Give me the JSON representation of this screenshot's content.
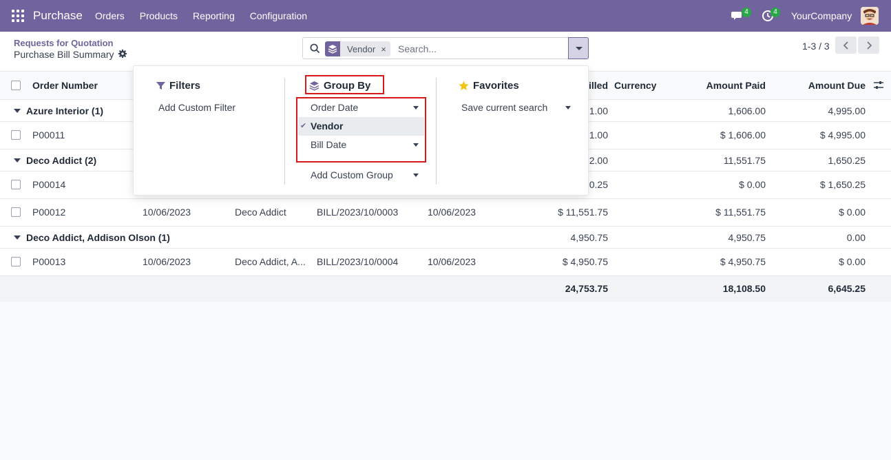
{
  "navbar": {
    "app_name": "Purchase",
    "menu": [
      "Orders",
      "Products",
      "Reporting",
      "Configuration"
    ],
    "messages_badge": "4",
    "activities_badge": "4",
    "company": "YourCompany",
    "brand_color": "#71639e"
  },
  "control_panel": {
    "breadcrumb_parent": "Requests for Quotation",
    "breadcrumb_current": "Purchase Bill Summary",
    "search": {
      "facet_label": "Vendor",
      "facet_remove": "×",
      "placeholder": "Search..."
    },
    "pager": "1-3 / 3"
  },
  "table": {
    "headers": {
      "order_number": "Order Number",
      "billed": "illed",
      "currency": "Currency",
      "amount_paid": "Amount Paid",
      "amount_due": "Amount Due"
    },
    "groups": [
      {
        "label": "Azure Interior (1)",
        "billed": "1.00",
        "paid": "1,606.00",
        "due": "4,995.00",
        "rows": [
          {
            "order": "P00011",
            "order_date": "",
            "vendor": "",
            "bill": "",
            "bill_date": "",
            "billed": "1.00",
            "paid": "$ 1,606.00",
            "due": "$ 4,995.00"
          }
        ]
      },
      {
        "label": "Deco Addict (2)",
        "billed": "2.00",
        "paid": "11,551.75",
        "due": "1,650.25",
        "rows": [
          {
            "order": "P00014",
            "order_date": "",
            "vendor": "",
            "bill": "",
            "bill_date": "",
            "billed": "0.25",
            "paid": "$ 0.00",
            "due": "$ 1,650.25"
          },
          {
            "order": "P00012",
            "order_date": "10/06/2023",
            "vendor": "Deco Addict",
            "bill": "BILL/2023/10/0003",
            "bill_date": "10/06/2023",
            "billed": "$ 11,551.75",
            "paid": "$ 11,551.75",
            "due": "$ 0.00"
          }
        ]
      },
      {
        "label": "Deco Addict, Addison Olson (1)",
        "billed": "4,950.75",
        "paid": "4,950.75",
        "due": "0.00",
        "rows": [
          {
            "order": "P00013",
            "order_date": "10/06/2023",
            "vendor": "Deco Addict, A...",
            "bill": "BILL/2023/10/0004",
            "bill_date": "10/06/2023",
            "billed": "$ 4,950.75",
            "paid": "$ 4,950.75",
            "due": "$ 0.00"
          }
        ]
      }
    ],
    "totals": {
      "billed": "24,753.75",
      "paid": "18,108.50",
      "due": "6,645.25"
    }
  },
  "dropdown": {
    "filters_title": "Filters",
    "add_custom_filter": "Add Custom Filter",
    "group_by_title": "Group By",
    "group_by_options": [
      {
        "label": "Order Date",
        "selected": false
      },
      {
        "label": "Vendor",
        "selected": true
      },
      {
        "label": "Bill Date",
        "selected": false
      }
    ],
    "add_custom_group": "Add Custom Group",
    "favorites_title": "Favorites",
    "save_current_search": "Save current search",
    "check_mark": "✔",
    "highlight_color": "#d9181c"
  }
}
